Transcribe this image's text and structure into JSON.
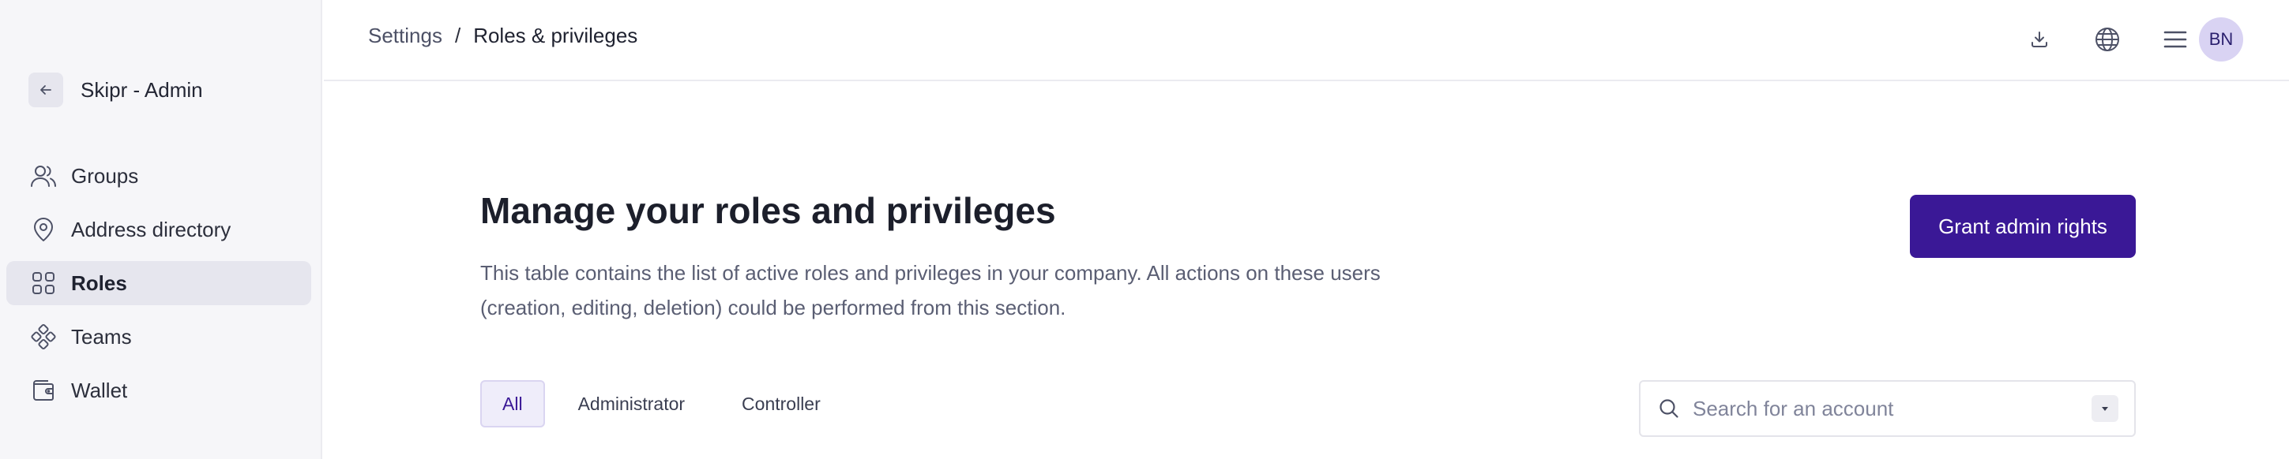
{
  "sidebar": {
    "app_title": "Skipr - Admin",
    "items": [
      {
        "label": "Groups",
        "icon": "users-icon",
        "active": false
      },
      {
        "label": "Address directory",
        "icon": "map-pin-icon",
        "active": false
      },
      {
        "label": "Roles",
        "icon": "grid-icon",
        "active": true
      },
      {
        "label": "Teams",
        "icon": "teams-icon",
        "active": false
      },
      {
        "label": "Wallet",
        "icon": "wallet-icon",
        "active": false
      }
    ]
  },
  "header": {
    "breadcrumb": {
      "root": "Settings",
      "separator": "/",
      "current": "Roles & privileges"
    },
    "avatar_initials": "BN"
  },
  "main": {
    "title": "Manage your roles and privileges",
    "description": "This table contains the list of active roles and privileges in your company. All actions on these users (creation, editing, deletion) could be performed from this section.",
    "grant_button": "Grant admin rights",
    "tabs": [
      {
        "label": "All",
        "active": true
      },
      {
        "label": "Administrator",
        "active": false
      },
      {
        "label": "Controller",
        "active": false
      }
    ],
    "search": {
      "placeholder": "Search for an account"
    }
  },
  "colors": {
    "accent": "#3a1896",
    "sidebar_bg": "#f6f6f9",
    "active_nav_bg": "#e6e6ee",
    "avatar_bg": "#d9d3f3"
  }
}
